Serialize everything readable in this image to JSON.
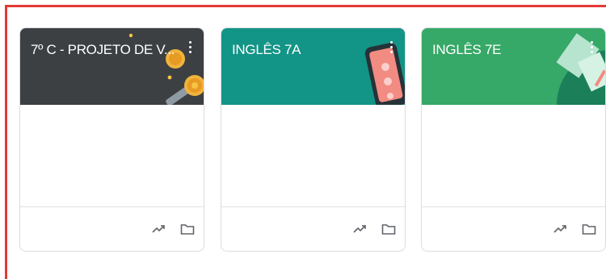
{
  "cards": [
    {
      "title": "7º C - PROJETO DE V...",
      "banner_color": "#3c4043",
      "banner_illustration": "coins-icon"
    },
    {
      "title": "INGLÊS 7A",
      "banner_color": "#129486",
      "banner_illustration": "phone-icon"
    },
    {
      "title": "INGLÊS 7E",
      "banner_color": "#36a867",
      "banner_illustration": "papers-icon"
    }
  ],
  "icons": {
    "more": "more-vert-icon",
    "trending": "trending-up-icon",
    "folder": "folder-icon"
  },
  "colors": {
    "highlight_border": "#e53935"
  }
}
